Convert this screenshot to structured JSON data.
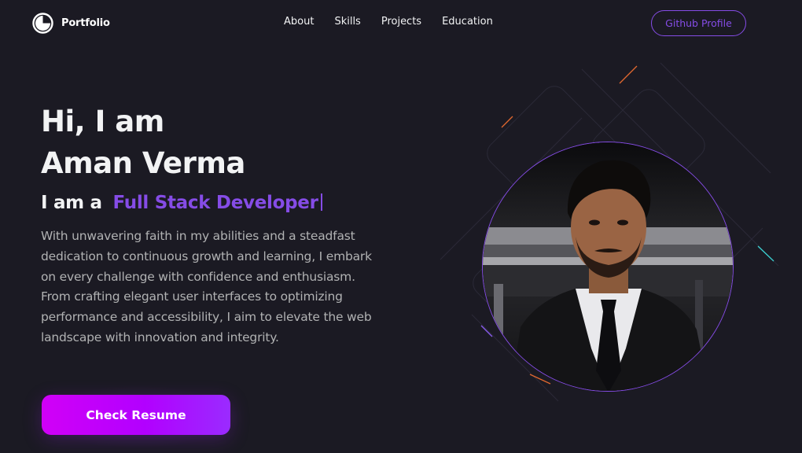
{
  "nav": {
    "logo_text": "Portfolio",
    "logo_icon": "portfolio-logo-icon",
    "links": [
      {
        "label": "About"
      },
      {
        "label": "Skills"
      },
      {
        "label": "Projects"
      },
      {
        "label": "Education"
      }
    ],
    "github_label": "Github Profile"
  },
  "hero": {
    "greeting": "Hi, I am",
    "name": "Aman Verma",
    "role_prefix": "I am a",
    "role": "Full Stack Developer",
    "description": "With unwavering faith in my abilities and a steadfast dedication to continuous growth and learning, I embark on every challenge with confidence and enthusiasm. From crafting elegant user interfaces to optimizing performance and accessibility, I aim to elevate the web landscape with innovation and integrity.",
    "resume_label": "Check Resume",
    "profile_image": "profile-photo"
  },
  "colors": {
    "background": "#1b1a23",
    "accent": "#854ce6",
    "text_primary": "#f2f3f4",
    "text_secondary": "#b1b2b3",
    "button_gradient_start": "#d100f7",
    "button_gradient_end": "#9a2bff"
  }
}
